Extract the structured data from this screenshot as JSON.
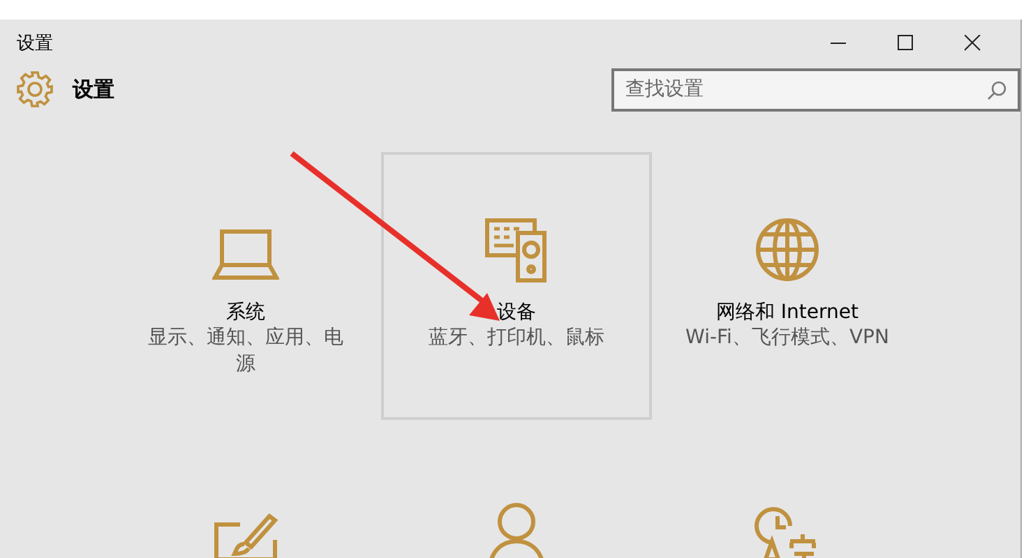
{
  "window": {
    "title": "设置"
  },
  "header": {
    "title": "设置",
    "search": {
      "placeholder": "查找设置"
    }
  },
  "tiles": [
    {
      "kind": "laptop",
      "title": "系统",
      "subtitle": "显示、通知、应用、电源",
      "selected": false
    },
    {
      "kind": "devices",
      "title": "设备",
      "subtitle": "蓝牙、打印机、鼠标",
      "selected": true
    },
    {
      "kind": "globe",
      "title": "网络和 Internet",
      "subtitle": "Wi-Fi、飞行模式、VPN",
      "selected": false
    },
    {
      "kind": "personalize",
      "selected": false
    },
    {
      "kind": "person",
      "selected": false
    },
    {
      "kind": "language",
      "selected": false
    }
  ]
}
